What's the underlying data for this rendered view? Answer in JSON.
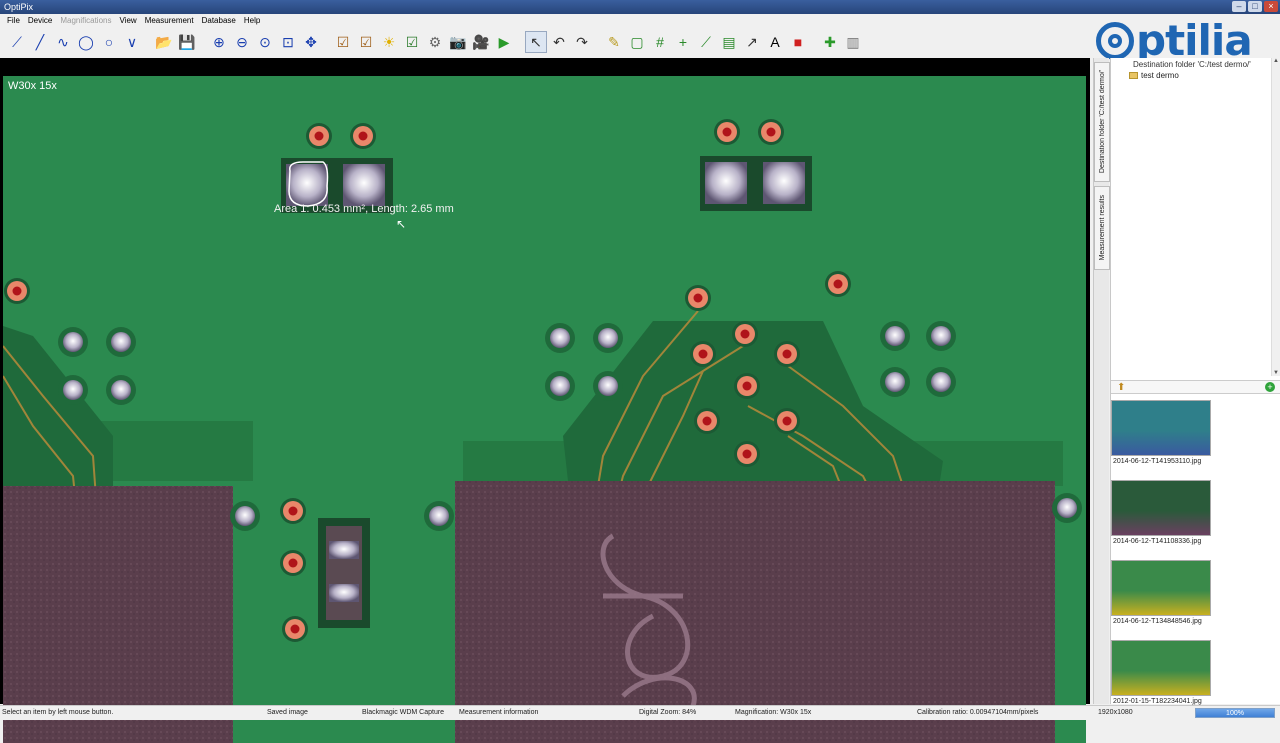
{
  "window": {
    "title": "OptiPix"
  },
  "menu": [
    {
      "label": "File",
      "enabled": true
    },
    {
      "label": "Device",
      "enabled": true
    },
    {
      "label": "Magnifications",
      "enabled": false
    },
    {
      "label": "View",
      "enabled": true
    },
    {
      "label": "Measurement",
      "enabled": true
    },
    {
      "label": "Database",
      "enabled": true
    },
    {
      "label": "Help",
      "enabled": true
    }
  ],
  "toolbar": {
    "tools": [
      {
        "name": "line-tool-icon",
        "glyph": "⟋",
        "color": "#1a3fb0"
      },
      {
        "name": "segment-tool-icon",
        "glyph": "╱",
        "color": "#1a3fb0"
      },
      {
        "name": "curve-tool-icon",
        "glyph": "∿",
        "color": "#1a3fb0"
      },
      {
        "name": "freehand-area-icon",
        "glyph": "◯",
        "color": "#1a3fb0"
      },
      {
        "name": "circle-tool-icon",
        "glyph": "○",
        "color": "#1a3fb0"
      },
      {
        "name": "angle-tool-icon",
        "glyph": "∨",
        "color": "#1a3fb0"
      },
      {
        "name": "open-folder-icon",
        "glyph": "📂",
        "color": "#c8962a"
      },
      {
        "name": "save-icon",
        "glyph": "💾",
        "color": "#2a4ea8"
      },
      {
        "name": "zoom-in-icon",
        "glyph": "⊕",
        "color": "#1a3fb0"
      },
      {
        "name": "zoom-out-icon",
        "glyph": "⊖",
        "color": "#1a3fb0"
      },
      {
        "name": "zoom-fit-icon",
        "glyph": "⊙",
        "color": "#1a3fb0"
      },
      {
        "name": "zoom-window-icon",
        "glyph": "⊡",
        "color": "#1a3fb0"
      },
      {
        "name": "pan-icon",
        "glyph": "✥",
        "color": "#1a3fb0"
      },
      {
        "name": "checkbox-image-icon",
        "glyph": "☑",
        "color": "#a0601a"
      },
      {
        "name": "checkbox-image-2-icon",
        "glyph": "☑",
        "color": "#a0601a"
      },
      {
        "name": "brightness-icon",
        "glyph": "☀",
        "color": "#e0b000"
      },
      {
        "name": "check-tool-icon",
        "glyph": "☑",
        "color": "#2a7a2a"
      },
      {
        "name": "settings-icon",
        "glyph": "⚙",
        "color": "#666666"
      },
      {
        "name": "camera-icon",
        "glyph": "📷",
        "color": "#444444"
      },
      {
        "name": "video-camera-icon",
        "glyph": "🎥",
        "color": "#444444"
      },
      {
        "name": "play-icon",
        "glyph": "▶",
        "color": "#2a9a2a"
      },
      {
        "name": "pointer-icon",
        "glyph": "↖",
        "color": "#333333",
        "selected": true
      },
      {
        "name": "undo-icon",
        "glyph": "↶",
        "color": "#333333"
      },
      {
        "name": "redo-icon",
        "glyph": "↷",
        "color": "#333333"
      },
      {
        "name": "eraser-icon",
        "glyph": "✎",
        "color": "#b89a20"
      },
      {
        "name": "rectangle-icon",
        "glyph": "▢",
        "color": "#2a8a2a"
      },
      {
        "name": "grid-icon",
        "glyph": "#",
        "color": "#2a8a2a"
      },
      {
        "name": "crosshair-icon",
        "glyph": "+",
        "color": "#2a8a2a"
      },
      {
        "name": "ruler-diagonal-icon",
        "glyph": "⟋",
        "color": "#2a8a2a"
      },
      {
        "name": "ruler-icon",
        "glyph": "▤",
        "color": "#2a8a2a"
      },
      {
        "name": "annotation-arrow-icon",
        "glyph": "↗",
        "color": "#333333"
      },
      {
        "name": "text-icon",
        "glyph": "A",
        "color": "#000000"
      },
      {
        "name": "color-palette-icon",
        "glyph": "■",
        "color": "#d02020"
      },
      {
        "name": "add-icon",
        "glyph": "✚",
        "color": "#2a9a2a"
      },
      {
        "name": "database-icon",
        "glyph": "▥",
        "color": "#777777"
      }
    ]
  },
  "viewer": {
    "magnification_label": "W30x 15x",
    "measurement_text": "Area 1: 0.453 mm², Length: 2.65 mm"
  },
  "side_tabs": [
    "Destination folder 'C:/test dermo/'",
    "Measurement results"
  ],
  "right_panel": {
    "destination_header": "Destination folder 'C:/test dermo/'",
    "tree_item": "test dermo",
    "thumbnails": [
      {
        "caption": "2014-06-12-T141953110.jpg"
      },
      {
        "caption": "2014-06-12-T141108336.jpg"
      },
      {
        "caption": "2014-06-12-T134848546.jpg"
      },
      {
        "caption": "2012-01-15-T182234041.jpg"
      }
    ]
  },
  "status": {
    "hint": "Select an item by left mouse button.",
    "saved": "Saved image",
    "device": "Blackmagic WDM Capture",
    "measurement_info": "Measurement information",
    "digital_zoom": "Digital Zoom: 84%",
    "magnification": "Magnification: W30x 15x",
    "calibration": "Calibration ratio: 0.00947104mm/pixels",
    "resolution": "1920x1080",
    "progress_label": "100%",
    "progress_value": 1.0
  },
  "brand": {
    "logo_text": "ptilia",
    "color": "#1f66b3"
  }
}
